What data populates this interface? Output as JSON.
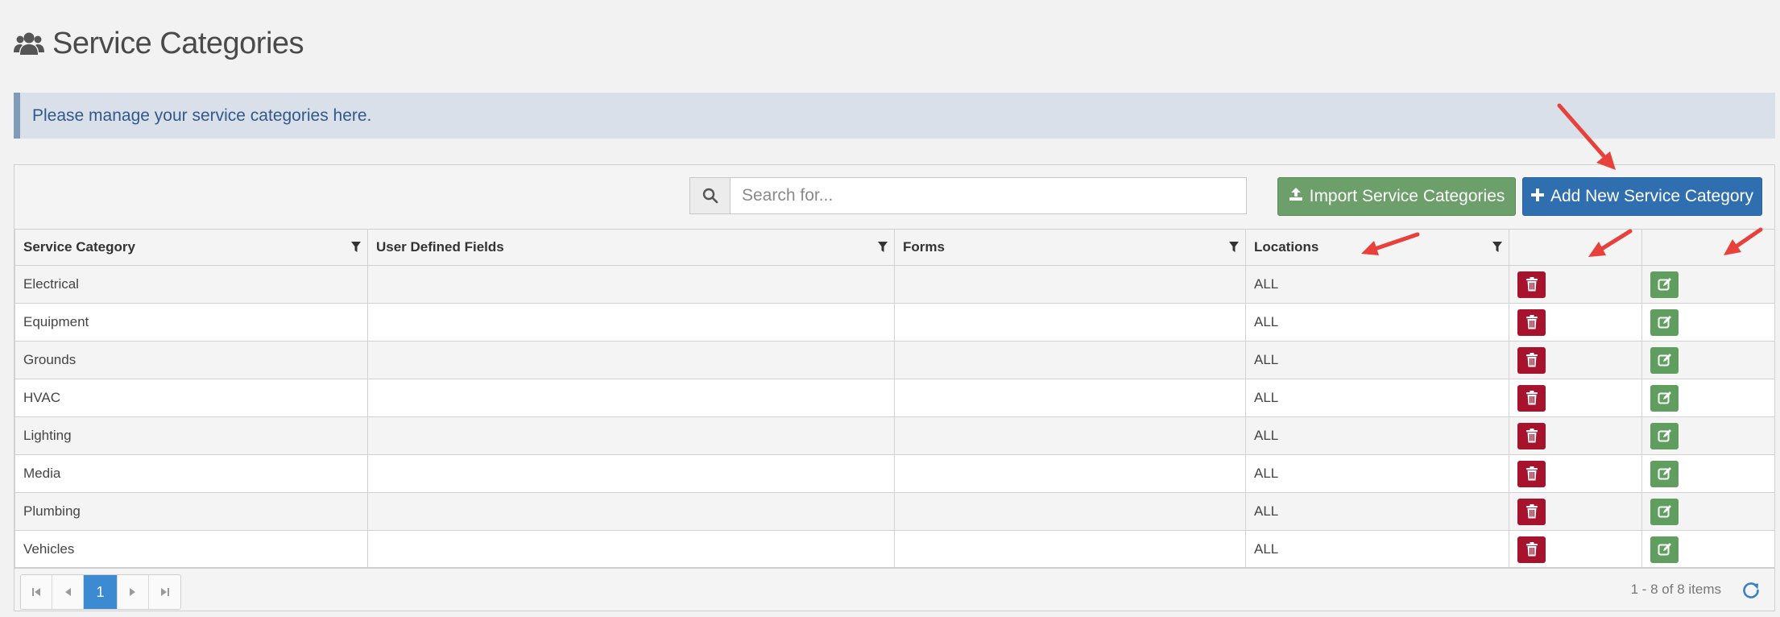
{
  "page": {
    "title": "Service Categories",
    "header_icon": "users-icon"
  },
  "info": {
    "message": "Please manage your service categories here."
  },
  "toolbar": {
    "search_placeholder": "Search for...",
    "search_icon": "search-icon",
    "import_label": "Import Service Categories",
    "import_icon": "upload-icon",
    "add_label": "Add New Service Category",
    "add_icon": "plus-icon"
  },
  "grid": {
    "columns": [
      "Service Category",
      "User Defined Fields",
      "Forms",
      "Locations",
      "",
      ""
    ],
    "rows": [
      {
        "category": "Electrical",
        "udf": "",
        "forms": "",
        "locations": "ALL"
      },
      {
        "category": "Equipment",
        "udf": "",
        "forms": "",
        "locations": "ALL"
      },
      {
        "category": "Grounds",
        "udf": "",
        "forms": "",
        "locations": "ALL"
      },
      {
        "category": "HVAC",
        "udf": "",
        "forms": "",
        "locations": "ALL"
      },
      {
        "category": "Lighting",
        "udf": "",
        "forms": "",
        "locations": "ALL"
      },
      {
        "category": "Media",
        "udf": "",
        "forms": "",
        "locations": "ALL"
      },
      {
        "category": "Plumbing",
        "udf": "",
        "forms": "",
        "locations": "ALL"
      },
      {
        "category": "Vehicles",
        "udf": "",
        "forms": "",
        "locations": "ALL"
      }
    ]
  },
  "pager": {
    "current_page": "1",
    "info": "1 - 8 of 8 items"
  },
  "colors": {
    "delete_button": "#a7122d",
    "edit_button": "#5f9e5f",
    "add_button": "#2f6fb0",
    "import_button": "#6c9f6a",
    "annotation_arrow": "#e8403b"
  }
}
